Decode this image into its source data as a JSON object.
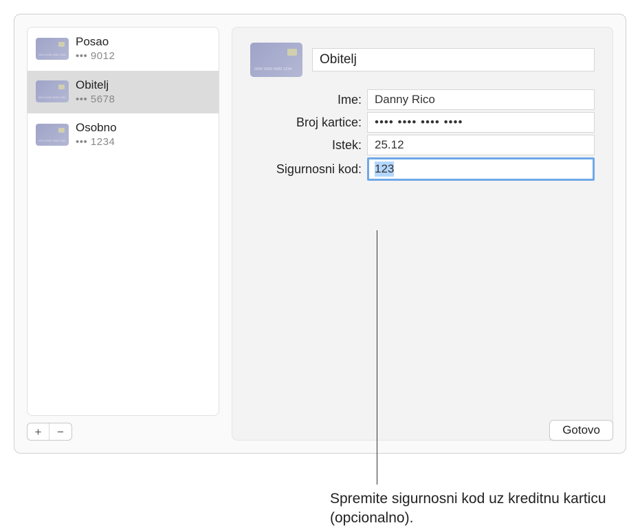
{
  "sidebar": {
    "items": [
      {
        "title": "Posao",
        "sub": "••• 9012"
      },
      {
        "title": "Obitelj",
        "sub": "••• 5678"
      },
      {
        "title": "Osobno",
        "sub": "••• 1234"
      }
    ],
    "selectedIndex": 1
  },
  "detail": {
    "title_value": "Obitelj",
    "fields": {
      "name": {
        "label": "Ime:",
        "value": "Danny Rico"
      },
      "card_number": {
        "label": "Broj kartice:",
        "value": "•••• •••• •••• ••••"
      },
      "expiry": {
        "label": "Istek:",
        "value": "25.12"
      },
      "security_code": {
        "label": "Sigurnosni kod:",
        "value": "123"
      }
    }
  },
  "buttons": {
    "done": "Gotovo",
    "add": "+",
    "remove": "−"
  },
  "callout": "Spremite sigurnosni kod uz kreditnu karticu (opcionalno)."
}
